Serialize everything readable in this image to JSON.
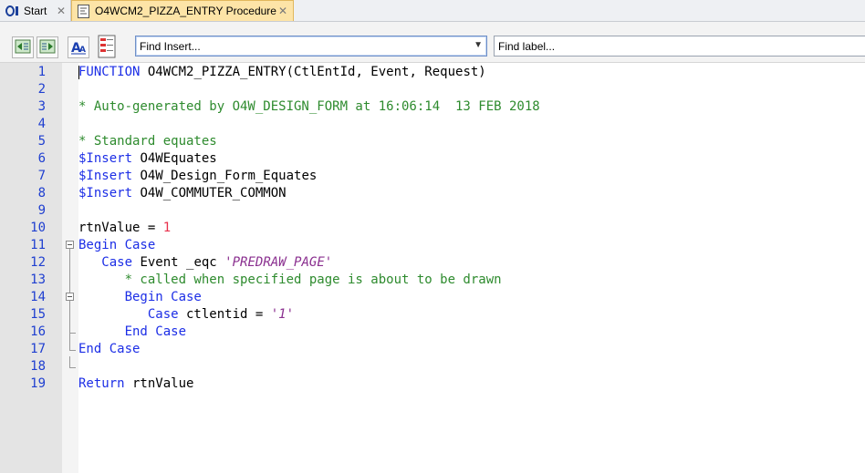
{
  "tabs": [
    {
      "label": "Start",
      "icon": "oi-logo-icon"
    },
    {
      "label": "O4WCM2_PIZZA_ENTRY Procedure",
      "icon": "procedure-document-icon",
      "active": true
    }
  ],
  "toolbar": {
    "buttons": [
      "outdent-icon",
      "indent-icon",
      "font-size-icon",
      "event-list-icon"
    ],
    "find_insert": "Find Insert...",
    "find_label": "Find label..."
  },
  "editor": {
    "line_numbers": [
      "1",
      "2",
      "3",
      "4",
      "5",
      "6",
      "7",
      "8",
      "9",
      "10",
      "11",
      "12",
      "13",
      "14",
      "15",
      "16",
      "17",
      "18",
      "19"
    ],
    "lines": [
      [
        {
          "t": "FUNCTION",
          "c": "kw"
        },
        {
          "t": " O4WCM2_PIZZA_ENTRY(CtlEntId, Event, Request)",
          "c": "pl"
        }
      ],
      [],
      [
        {
          "t": "* Auto-generated by O4W_DESIGN_FORM at 16:06:14  13 FEB 2018",
          "c": "cm"
        }
      ],
      [],
      [
        {
          "t": "* Standard equates",
          "c": "cm"
        }
      ],
      [
        {
          "t": "$Insert",
          "c": "kw"
        },
        {
          "t": " O4WEquates",
          "c": "pl"
        }
      ],
      [
        {
          "t": "$Insert",
          "c": "kw"
        },
        {
          "t": " O4W_Design_Form_Equates",
          "c": "pl"
        }
      ],
      [
        {
          "t": "$Insert",
          "c": "kw"
        },
        {
          "t": " O4W_COMMUTER_COMMON",
          "c": "pl"
        }
      ],
      [],
      [
        {
          "t": "rtnValue = ",
          "c": "pl"
        },
        {
          "t": "1",
          "c": "num"
        }
      ],
      [
        {
          "t": "Begin Case",
          "c": "kw"
        }
      ],
      [
        {
          "t": "   ",
          "c": "pl"
        },
        {
          "t": "Case",
          "c": "kw"
        },
        {
          "t": " Event _eqc ",
          "c": "pl"
        },
        {
          "t": "'PREDRAW_PAGE'",
          "c": "str"
        }
      ],
      [
        {
          "t": "      * called when specified page is about to be drawn",
          "c": "cm"
        }
      ],
      [
        {
          "t": "      ",
          "c": "pl"
        },
        {
          "t": "Begin Case",
          "c": "kw"
        }
      ],
      [
        {
          "t": "         ",
          "c": "pl"
        },
        {
          "t": "Case",
          "c": "kw"
        },
        {
          "t": " ctlentid = ",
          "c": "pl"
        },
        {
          "t": "'1'",
          "c": "str"
        }
      ],
      [
        {
          "t": "      ",
          "c": "pl"
        },
        {
          "t": "End Case",
          "c": "kw"
        }
      ],
      [
        {
          "t": "End Case",
          "c": "kw"
        }
      ],
      [],
      [
        {
          "t": "Return",
          "c": "kw"
        },
        {
          "t": " rtnValue",
          "c": "pl"
        }
      ]
    ]
  },
  "colors": {
    "keyword": "#1c2ee6",
    "comment": "#2e8b2e",
    "string": "#8a2f8f",
    "number": "#e8314c",
    "line_number": "#1f3fd0",
    "active_tab": "#fde4a7"
  }
}
